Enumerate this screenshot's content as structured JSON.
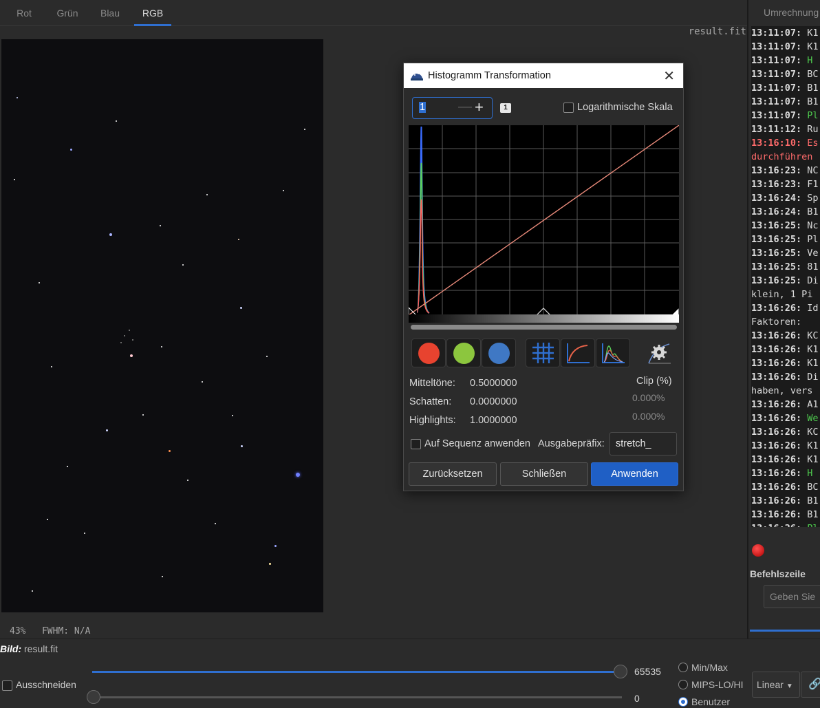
{
  "tabs": [
    {
      "label": "Rot"
    },
    {
      "label": "Grün"
    },
    {
      "label": "Blau"
    },
    {
      "label": "RGB",
      "active": true
    }
  ],
  "image": {
    "filename_overlay": "result.fit",
    "zoom": "43%",
    "fwhm": "FWHM: N/A"
  },
  "right_panel": {
    "tab_label": "Umrechnung",
    "log": [
      {
        "time": "13:11:07:",
        "text": "K1",
        "color": "normal"
      },
      {
        "time": "13:11:07:",
        "text": "K1",
        "color": "normal"
      },
      {
        "time": "13:11:07:",
        "text": "H",
        "color": "green"
      },
      {
        "time": "13:11:07:",
        "text": "BC",
        "color": "normal"
      },
      {
        "time": "13:11:07:",
        "text": "B1",
        "color": "normal"
      },
      {
        "time": "13:11:07:",
        "text": "B1",
        "color": "normal"
      },
      {
        "time": "13:11:07:",
        "text": "Pl",
        "color": "green"
      },
      {
        "time": "13:11:12:",
        "text": "Ru",
        "color": "normal"
      },
      {
        "time": "13:16:10:",
        "text": "Es",
        "color": "red"
      },
      {
        "time": "",
        "text": "durchführen",
        "color": "red"
      },
      {
        "time": "13:16:23:",
        "text": "NC",
        "color": "normal"
      },
      {
        "time": "13:16:23:",
        "text": "F1",
        "color": "normal"
      },
      {
        "time": "13:16:24:",
        "text": "Sp",
        "color": "normal"
      },
      {
        "time": "13:16:24:",
        "text": "B1",
        "color": "normal"
      },
      {
        "time": "13:16:25:",
        "text": "Nc",
        "color": "normal"
      },
      {
        "time": "13:16:25:",
        "text": "Pl",
        "color": "normal"
      },
      {
        "time": "13:16:25:",
        "text": "Ve",
        "color": "normal"
      },
      {
        "time": "13:16:25:",
        "text": "81",
        "color": "normal"
      },
      {
        "time": "13:16:25:",
        "text": "Di",
        "color": "normal"
      },
      {
        "time": "",
        "text": "klein, 1 Pi",
        "color": "normal"
      },
      {
        "time": "13:16:26:",
        "text": "Id",
        "color": "normal"
      },
      {
        "time": "",
        "text": "Faktoren:",
        "color": "normal"
      },
      {
        "time": "13:16:26:",
        "text": "KC",
        "color": "normal"
      },
      {
        "time": "13:16:26:",
        "text": "K1",
        "color": "normal"
      },
      {
        "time": "13:16:26:",
        "text": "K1",
        "color": "normal"
      },
      {
        "time": "13:16:26:",
        "text": "Di",
        "color": "normal"
      },
      {
        "time": "",
        "text": "haben, vers",
        "color": "normal"
      },
      {
        "time": "13:16:26:",
        "text": "A1",
        "color": "normal"
      },
      {
        "time": "13:16:26:",
        "text": "We",
        "color": "green"
      },
      {
        "time": "13:16:26:",
        "text": "KC",
        "color": "normal"
      },
      {
        "time": "13:16:26:",
        "text": "K1",
        "color": "normal"
      },
      {
        "time": "13:16:26:",
        "text": "K1",
        "color": "normal"
      },
      {
        "time": "13:16:26:",
        "text": "H",
        "color": "green"
      },
      {
        "time": "13:16:26:",
        "text": "BC",
        "color": "normal"
      },
      {
        "time": "13:16:26:",
        "text": "B1",
        "color": "normal"
      },
      {
        "time": "13:16:26:",
        "text": "B1",
        "color": "normal"
      },
      {
        "time": "13:16:26:",
        "text": "Pl",
        "color": "green"
      }
    ],
    "command_label": "Befehlszeile",
    "command_placeholder": "Geben Sie "
  },
  "bottom": {
    "bild_label": "Bild:",
    "bild_value": "result.fit",
    "crop_label": "Ausschneiden",
    "high_value": "65535",
    "low_value": "0",
    "high_fill_fraction": 1.0,
    "low_fill_fraction": 0.0,
    "modes": [
      {
        "label": "Min/Max",
        "selected": false
      },
      {
        "label": "MIPS-LO/HI",
        "selected": false
      },
      {
        "label": "Benutzer",
        "selected": true
      }
    ],
    "stretch": "Linear"
  },
  "dialog": {
    "title": "Histogramm Transformation",
    "layer_value": "1",
    "layer_badge": "1",
    "log_scale_label": "Logarithmische Skala",
    "midtones_label": "Mitteltöne:",
    "midtones_value": "0.5000000",
    "shadows_label": "Schatten:",
    "shadows_value": "0.0000000",
    "highlights_label": "Highlights:",
    "highlights_value": "1.0000000",
    "clip_label": "Clip (%)",
    "clip_low": "0.000%",
    "clip_high": "0.000%",
    "sequence_label": "Auf Sequenz anwenden",
    "prefix_label": "Ausgabepräfix:",
    "prefix_value": "stretch_",
    "reset_label": "Zurücksetzen",
    "close_label": "Schließen",
    "apply_label": "Anwenden",
    "channel_colors": {
      "red": "#e8432f",
      "green": "#8cc63e",
      "blue": "#3f78c4"
    },
    "curve_color": "#e98a7a"
  }
}
